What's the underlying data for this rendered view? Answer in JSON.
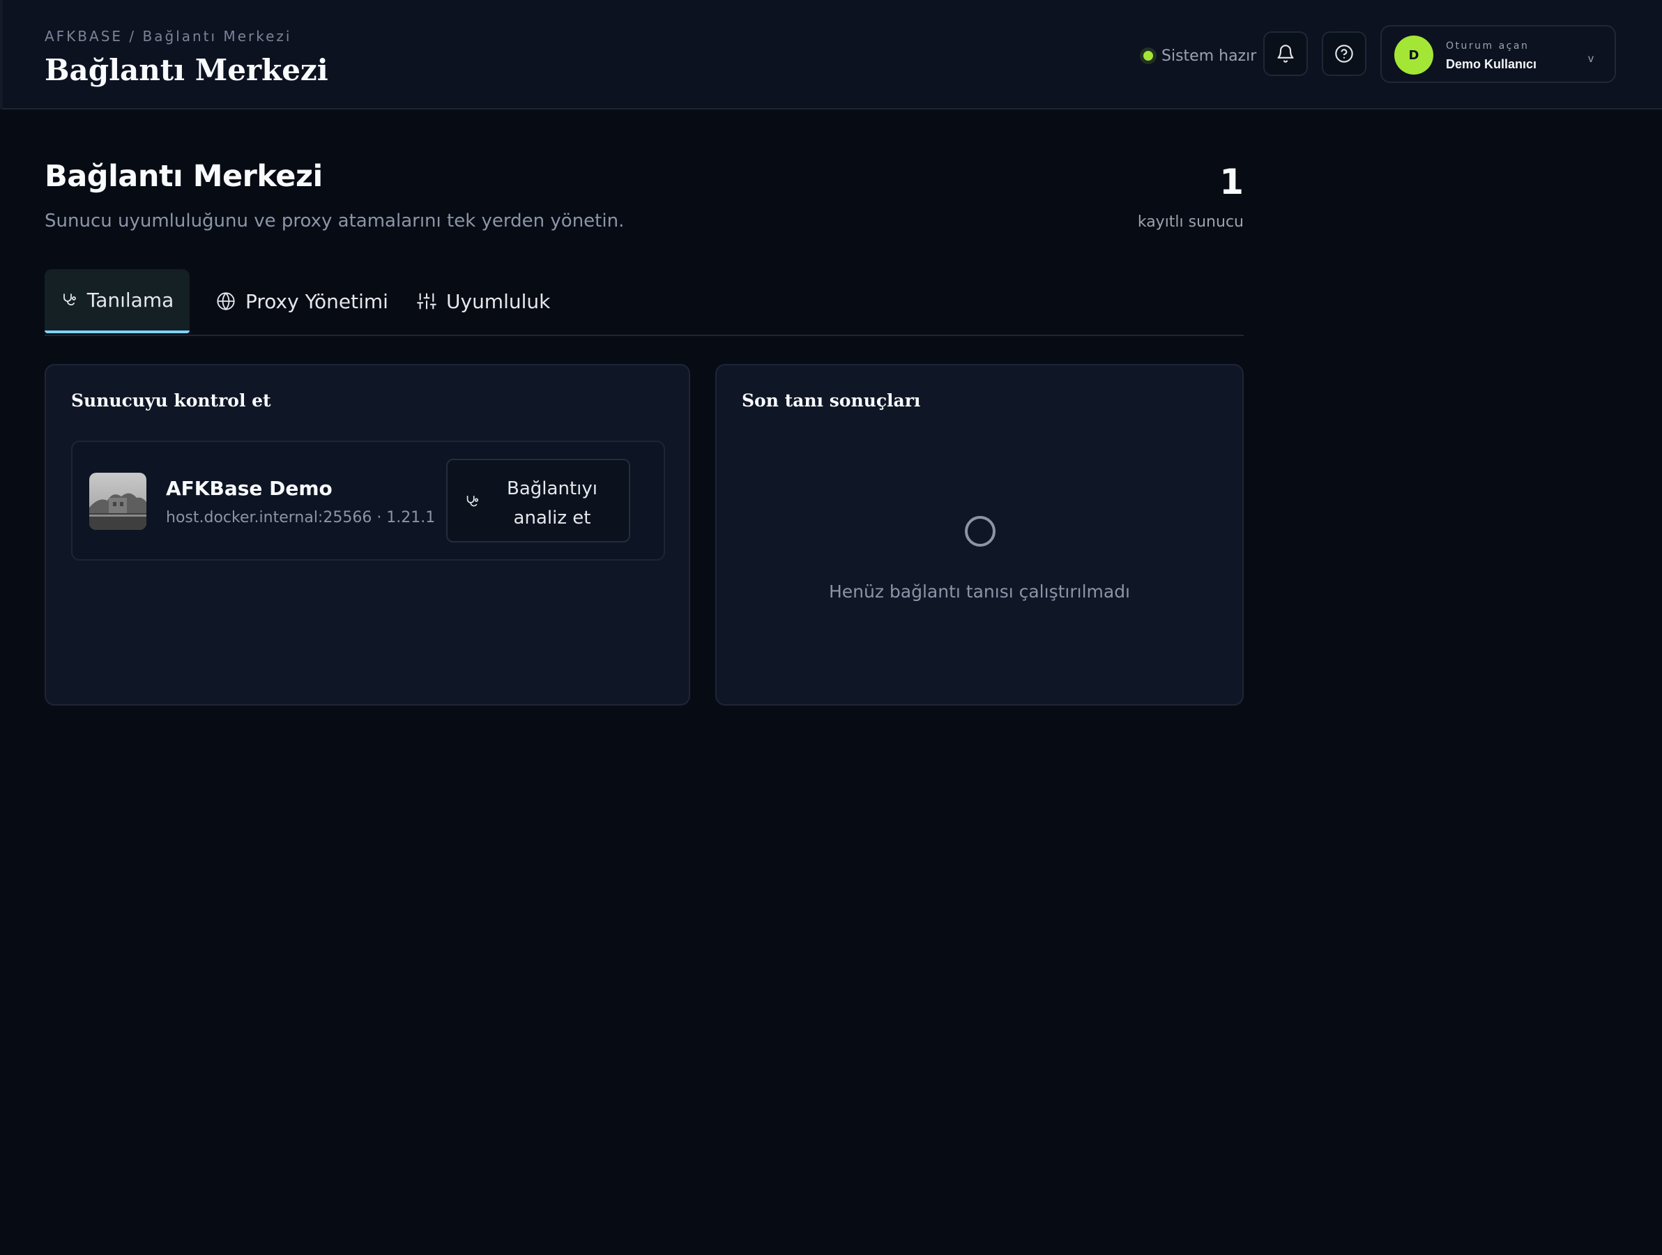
{
  "header": {
    "breadcrumb_root": "AFKBASE",
    "breadcrumb_separator": "/",
    "breadcrumb_current": "Bağlantı Merkezi",
    "title": "Bağlantı Merkezi",
    "status_text": "Sistem hazır",
    "status_color": "#a3e635",
    "bell_icon": "bell-icon",
    "help_icon": "help-circle-icon",
    "user": {
      "avatar_letter": "D",
      "label": "Oturum açan",
      "name": "Demo Kullanıcı",
      "chevron": "v"
    }
  },
  "page": {
    "title": "Bağlantı Merkezi",
    "subtitle": "Sunucu uyumluluğunu ve proxy atamalarını tek yerden yönetin.",
    "server_count": "1",
    "server_count_label": "kayıtlı sunucu"
  },
  "tabs": [
    {
      "label": "Tanılama",
      "icon": "stethoscope-icon",
      "active": true
    },
    {
      "label": "Proxy Yönetimi",
      "icon": "globe-icon",
      "active": false
    },
    {
      "label": "Uyumluluk",
      "icon": "sliders-icon",
      "active": false
    }
  ],
  "check_card": {
    "title": "Sunucuyu kontrol et",
    "server": {
      "name": "AFKBase Demo",
      "host": "host.docker.internal:25566 · 1.21.1",
      "action_line1": "Bağlantıyı",
      "action_line2": "analiz et"
    }
  },
  "results_card": {
    "title": "Son tanı sonuçları",
    "empty_text": "Henüz bağlantı tanısı çalıştırılmadı"
  },
  "colors": {
    "background": "#070b14",
    "accent": "#a3e635",
    "tab_underline": "#7dd3fc"
  }
}
